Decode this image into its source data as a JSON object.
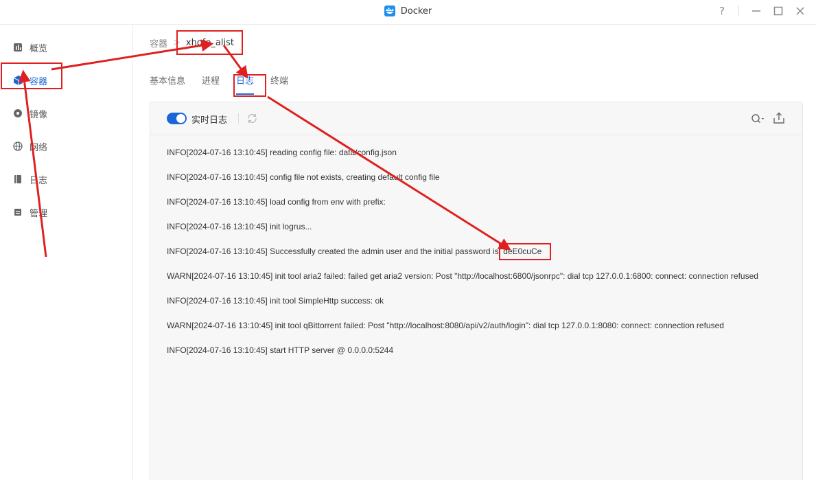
{
  "window": {
    "title": "Docker",
    "help_icon": "question-icon",
    "controls": [
      "minimize-icon",
      "maximize-icon",
      "close-icon"
    ]
  },
  "sidebar": {
    "items": [
      {
        "label": "概览",
        "icon": "overview-icon",
        "active": false
      },
      {
        "label": "容器",
        "icon": "container-icon",
        "active": true
      },
      {
        "label": "镜像",
        "icon": "image-icon",
        "active": false
      },
      {
        "label": "网络",
        "icon": "network-icon",
        "active": false
      },
      {
        "label": "日志",
        "icon": "log-icon",
        "active": false
      },
      {
        "label": "管理",
        "icon": "manage-icon",
        "active": false
      }
    ]
  },
  "breadcrumb": {
    "parent": "容器",
    "separator": ">",
    "current": "xhofe_alist"
  },
  "tabs": [
    {
      "label": "基本信息",
      "active": false
    },
    {
      "label": "进程",
      "active": false
    },
    {
      "label": "日志",
      "active": true
    },
    {
      "label": "终端",
      "active": false
    }
  ],
  "log_panel": {
    "realtime_label": "实时日志",
    "realtime_enabled": true,
    "lines": [
      "INFO[2024-07-16 13:10:45] reading config file: data/config.json",
      "INFO[2024-07-16 13:10:45] config file not exists, creating default config file",
      "INFO[2024-07-16 13:10:45] load config from env with prefix:",
      "INFO[2024-07-16 13:10:45] init logrus...",
      "INFO[2024-07-16 13:10:45] Successfully created the admin user and the initial password is: deE0cuCe",
      "WARN[2024-07-16 13:10:45] init tool aria2 failed: failed get aria2 version: Post \"http://localhost:6800/jsonrpc\": dial tcp 127.0.0.1:6800: connect: connection refused",
      "INFO[2024-07-16 13:10:45] init tool SimpleHttp success: ok",
      "WARN[2024-07-16 13:10:45] init tool qBittorrent failed: Post \"http://localhost:8080/api/v2/auth/login\": dial tcp 127.0.0.1:8080: connect: connection refused",
      "INFO[2024-07-16 13:10:45] start HTTP server @ 0.0.0.0:5244"
    ]
  },
  "colors": {
    "accent": "#1a66d8",
    "annotation": "#e02020"
  }
}
